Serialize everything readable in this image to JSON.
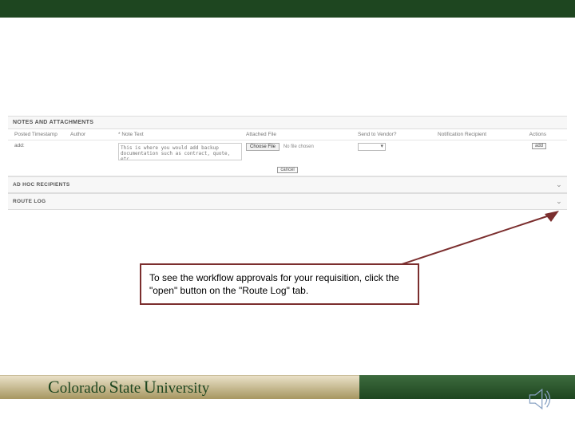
{
  "panels": {
    "notes_attachments": "NOTES AND ATTACHMENTS",
    "adhoc": "AD HOC RECIPIENTS",
    "routelog": "ROUTE LOG"
  },
  "columns": {
    "posted": "Posted Timestamp",
    "author": "Author",
    "note": "* Note Text",
    "file": "Attached File",
    "vendor": "Send to Vendor?",
    "notif": "Notification Recipient",
    "actions": "Actions"
  },
  "row": {
    "ts": "add:",
    "note_placeholder": "This is where you would add backup documentation such as contract, quote, etc.",
    "choose_file": "Choose File",
    "no_file": "No file chosen",
    "add_btn": "add",
    "cancel_btn": "cancel"
  },
  "callout": "To see the workflow approvals for your requisition, click the \"open\" button on the \"Route Log\" tab.",
  "footer": {
    "brand_c": "C",
    "brand_rest1": "olorado",
    "brand_s": "S",
    "brand_rest2": "tate",
    "brand_u": "U",
    "brand_rest3": "niversity"
  }
}
